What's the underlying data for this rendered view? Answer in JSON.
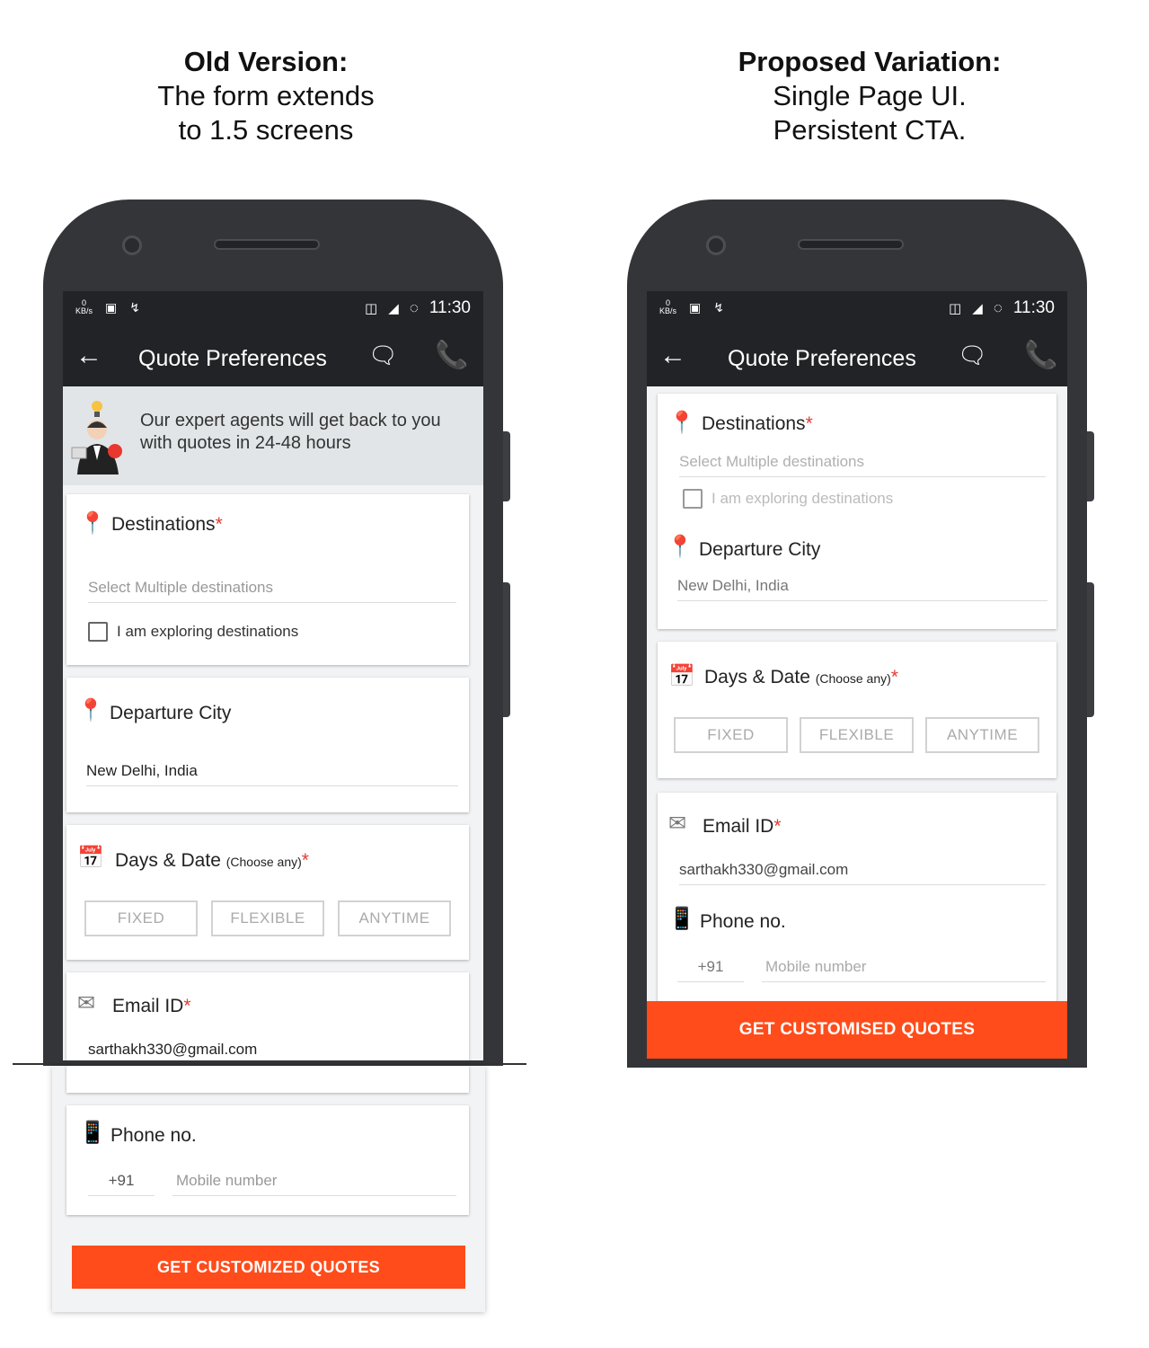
{
  "captions": {
    "left": {
      "title": "Old Version:",
      "line1": "The form extends",
      "line2": "to 1.5 screens"
    },
    "right": {
      "title": "Proposed Variation:",
      "line1": "Single Page UI.",
      "line2": "Persistent CTA."
    }
  },
  "status_bar": {
    "speed_top": "0",
    "speed_unit": "KB/s",
    "time": "11:30"
  },
  "app_bar": {
    "back_icon": "←",
    "title": "Quote Preferences",
    "chat_icon": "🗨",
    "call_icon": "📞"
  },
  "old_version": {
    "banner_text_1": "Our expert agents will get back to you",
    "banner_text_2": "with quotes in 24-48 hours",
    "destinations": {
      "label": "Destinations",
      "required": "*",
      "placeholder": "Select Multiple destinations",
      "checkbox_label": "I am exploring destinations"
    },
    "departure": {
      "label": "Departure City",
      "value": "New Delhi, India"
    },
    "days": {
      "label": "Days & Date",
      "sub": "(Choose any)",
      "required": "*",
      "options": [
        "FIXED",
        "FLEXIBLE",
        "ANYTIME"
      ]
    },
    "email": {
      "label": "Email ID",
      "required": "*",
      "value": "sarthakh330@gmail.com"
    },
    "phone": {
      "label": "Phone no.",
      "code": "+91",
      "placeholder": "Mobile number"
    },
    "cta": "GET CUSTOMIZED QUOTES"
  },
  "new_version": {
    "destinations": {
      "label": "Destinations",
      "required": "*",
      "placeholder": "Select Multiple destinations",
      "checkbox_label": "I am exploring destinations"
    },
    "departure": {
      "label": "Departure City",
      "value": "New Delhi, India"
    },
    "days": {
      "label": "Days & Date",
      "sub": "(Choose any)",
      "required": "*",
      "options": [
        "FIXED",
        "FLEXIBLE",
        "ANYTIME"
      ]
    },
    "email": {
      "label": "Email ID",
      "required": "*",
      "value": "sarthakh330@gmail.com"
    },
    "phone": {
      "label": "Phone no.",
      "code": "+91",
      "placeholder": "Mobile number"
    },
    "cta": "GET CUSTOMISED QUOTES"
  },
  "colors": {
    "cta": "#ff4c1a",
    "appbar": "#222326",
    "banner": "#e1e5e7",
    "required": "#e53935",
    "phone_body": "#333539"
  }
}
